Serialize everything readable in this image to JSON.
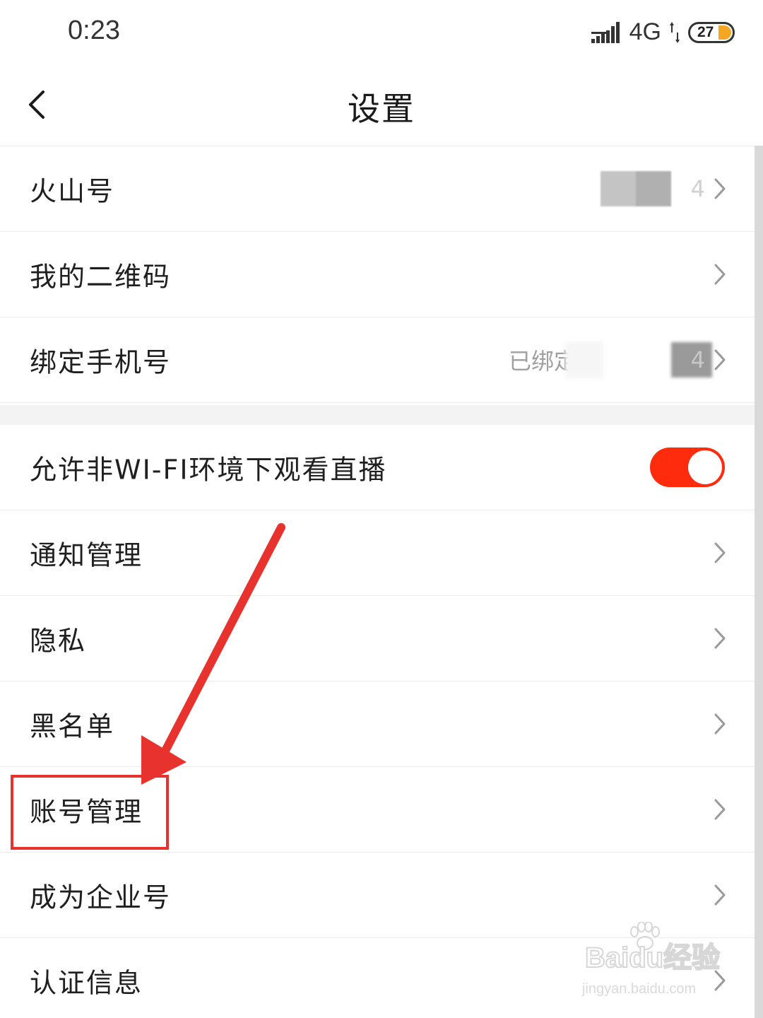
{
  "status_bar": {
    "time": "0:23",
    "network": "4G",
    "battery_level": "27",
    "battery_color": "#f5a623",
    "signal_icon": "signal-bars-icon",
    "data_icon": "data-arrows-icon"
  },
  "header": {
    "title": "设置",
    "back_icon": "chevron-left-icon"
  },
  "settings": {
    "group1": [
      {
        "label": "火山号",
        "value": "",
        "value_tail": "4",
        "redacted": true
      },
      {
        "label": "我的二维码",
        "value": ""
      },
      {
        "label": "绑定手机号",
        "value": "已绑定",
        "value_tail": "4",
        "redacted": true
      }
    ],
    "wifi_toggle": {
      "label": "允许非WI-FI环境下观看直播",
      "on": true,
      "on_color": "#fe2c0d"
    },
    "group2": [
      {
        "label": "通知管理"
      },
      {
        "label": "隐私"
      },
      {
        "label": "黑名单"
      },
      {
        "label": "账号管理",
        "highlighted": true
      },
      {
        "label": "成为企业号"
      },
      {
        "label": "认证信息"
      }
    ]
  },
  "annotation": {
    "color": "#e8322e"
  },
  "watermark": {
    "brand": "Baidu经验",
    "url": "jingyan.baidu.com"
  }
}
